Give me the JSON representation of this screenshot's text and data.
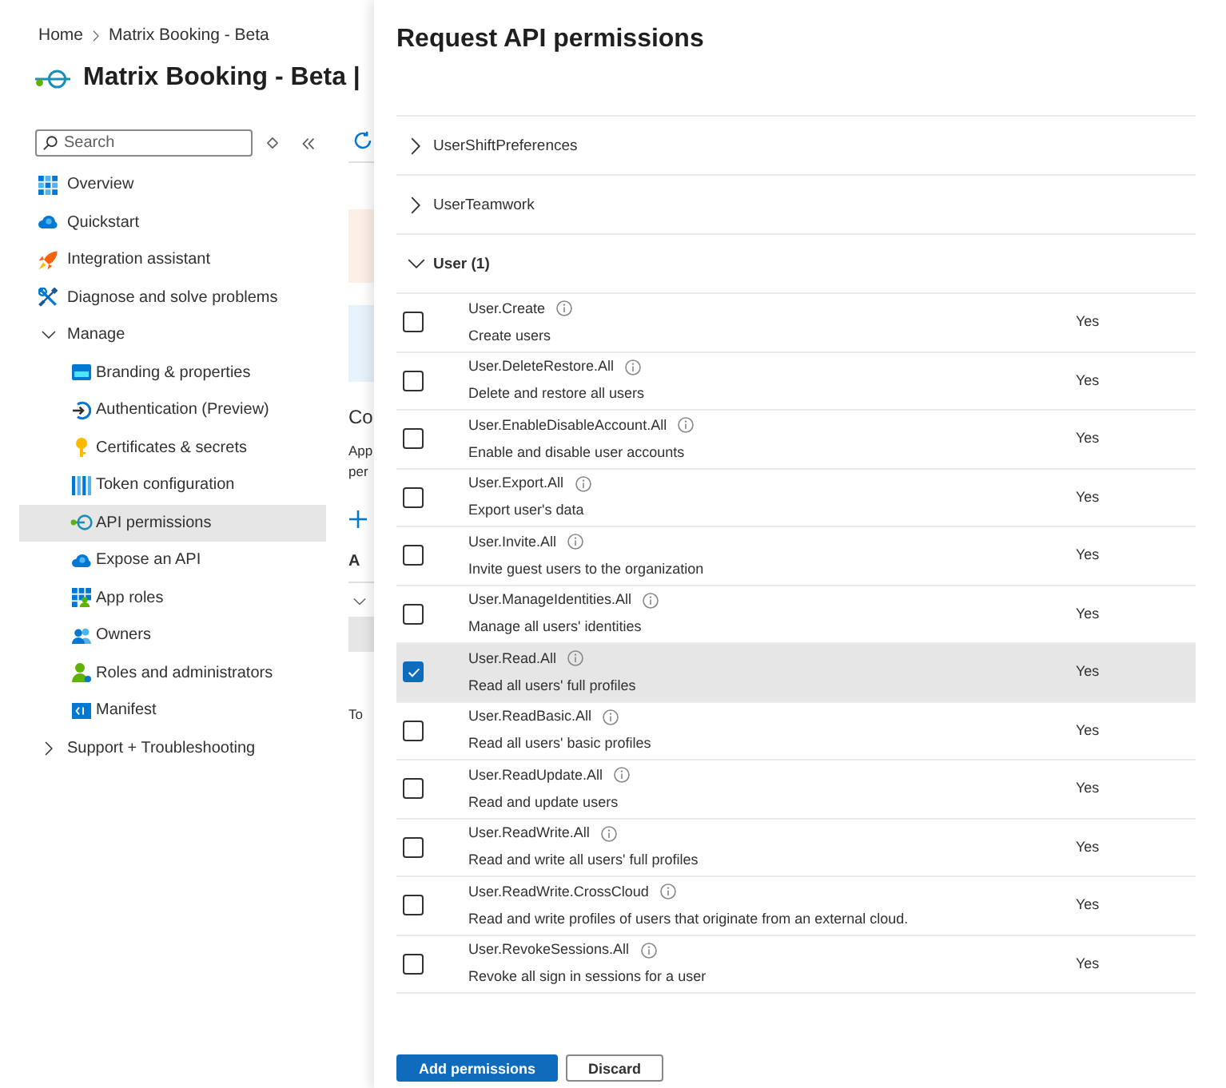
{
  "breadcrumb": [
    {
      "label": "Home"
    },
    {
      "label": "Matrix Booking - Beta"
    }
  ],
  "app": {
    "title": "Matrix Booking - Beta |"
  },
  "sidebar": {
    "search": {
      "placeholder": "Search"
    },
    "items": [
      {
        "label": "Overview",
        "kind": "link",
        "selected": false
      },
      {
        "label": "Quickstart",
        "kind": "link",
        "selected": false
      },
      {
        "label": "Integration assistant",
        "kind": "link",
        "selected": false
      },
      {
        "label": "Diagnose and solve problems",
        "kind": "link",
        "selected": false
      },
      {
        "label": "Manage",
        "kind": "group",
        "selected": false,
        "expanded": true,
        "children": [
          {
            "label": "Branding & properties",
            "kind": "link",
            "selected": false
          },
          {
            "label": "Authentication (Preview)",
            "kind": "link",
            "selected": false
          },
          {
            "label": "Certificates & secrets",
            "kind": "link",
            "selected": false
          },
          {
            "label": "Token configuration",
            "kind": "link",
            "selected": false
          },
          {
            "label": "API permissions",
            "kind": "link",
            "selected": true
          },
          {
            "label": "Expose an API",
            "kind": "link",
            "selected": false
          },
          {
            "label": "App roles",
            "kind": "link",
            "selected": false
          },
          {
            "label": "Owners",
            "kind": "link",
            "selected": false
          },
          {
            "label": "Roles and administrators",
            "kind": "link",
            "selected": false
          },
          {
            "label": "Manifest",
            "kind": "link",
            "selected": false
          }
        ]
      },
      {
        "label": "Support + Troubleshooting",
        "kind": "group",
        "selected": false,
        "expanded": false
      }
    ]
  },
  "background_page": {
    "heading": "Co",
    "text_lines": [
      "App",
      "per"
    ],
    "column_header": "A",
    "footer_text": "To"
  },
  "panel": {
    "title": "Request API permissions",
    "groups": [
      {
        "label": "UserShiftPreferences",
        "expanded": false
      },
      {
        "label": "UserTeamwork",
        "expanded": false
      },
      {
        "label": "User (1)",
        "expanded": true,
        "permissions": [
          {
            "name": "User.Create",
            "description": "Create users",
            "column_3": "Yes",
            "checked": false,
            "selected": false
          },
          {
            "name": "User.DeleteRestore.All",
            "description": "Delete and restore all users",
            "column_3": "Yes",
            "checked": false,
            "selected": false
          },
          {
            "name": "User.EnableDisableAccount.All",
            "description": "Enable and disable user accounts",
            "column_3": "Yes",
            "checked": false,
            "selected": false
          },
          {
            "name": "User.Export.All",
            "description": "Export user's data",
            "column_3": "Yes",
            "checked": false,
            "selected": false
          },
          {
            "name": "User.Invite.All",
            "description": "Invite guest users to the organization",
            "column_3": "Yes",
            "checked": false,
            "selected": false
          },
          {
            "name": "User.ManageIdentities.All",
            "description": "Manage all users' identities",
            "column_3": "Yes",
            "checked": false,
            "selected": false
          },
          {
            "name": "User.Read.All",
            "description": "Read all users' full profiles",
            "column_3": "Yes",
            "checked": true,
            "selected": true
          },
          {
            "name": "User.ReadBasic.All",
            "description": "Read all users' basic profiles",
            "column_3": "Yes",
            "checked": false,
            "selected": false
          },
          {
            "name": "User.ReadUpdate.All",
            "description": "Read and update users",
            "column_3": "Yes",
            "checked": false,
            "selected": false
          },
          {
            "name": "User.ReadWrite.All",
            "description": "Read and write all users' full profiles",
            "column_3": "Yes",
            "checked": false,
            "selected": false
          },
          {
            "name": "User.ReadWrite.CrossCloud",
            "description": "Read and write profiles of users that originate from an external cloud.",
            "column_3": "Yes",
            "checked": false,
            "selected": false
          },
          {
            "name": "User.RevokeSessions.All",
            "description": "Revoke all sign in sessions for a user",
            "column_3": "Yes",
            "checked": false,
            "selected": false
          }
        ]
      }
    ],
    "buttons": [
      {
        "label": "Add permissions",
        "kind": "primary"
      },
      {
        "label": "Discard",
        "kind": "secondary"
      }
    ]
  }
}
